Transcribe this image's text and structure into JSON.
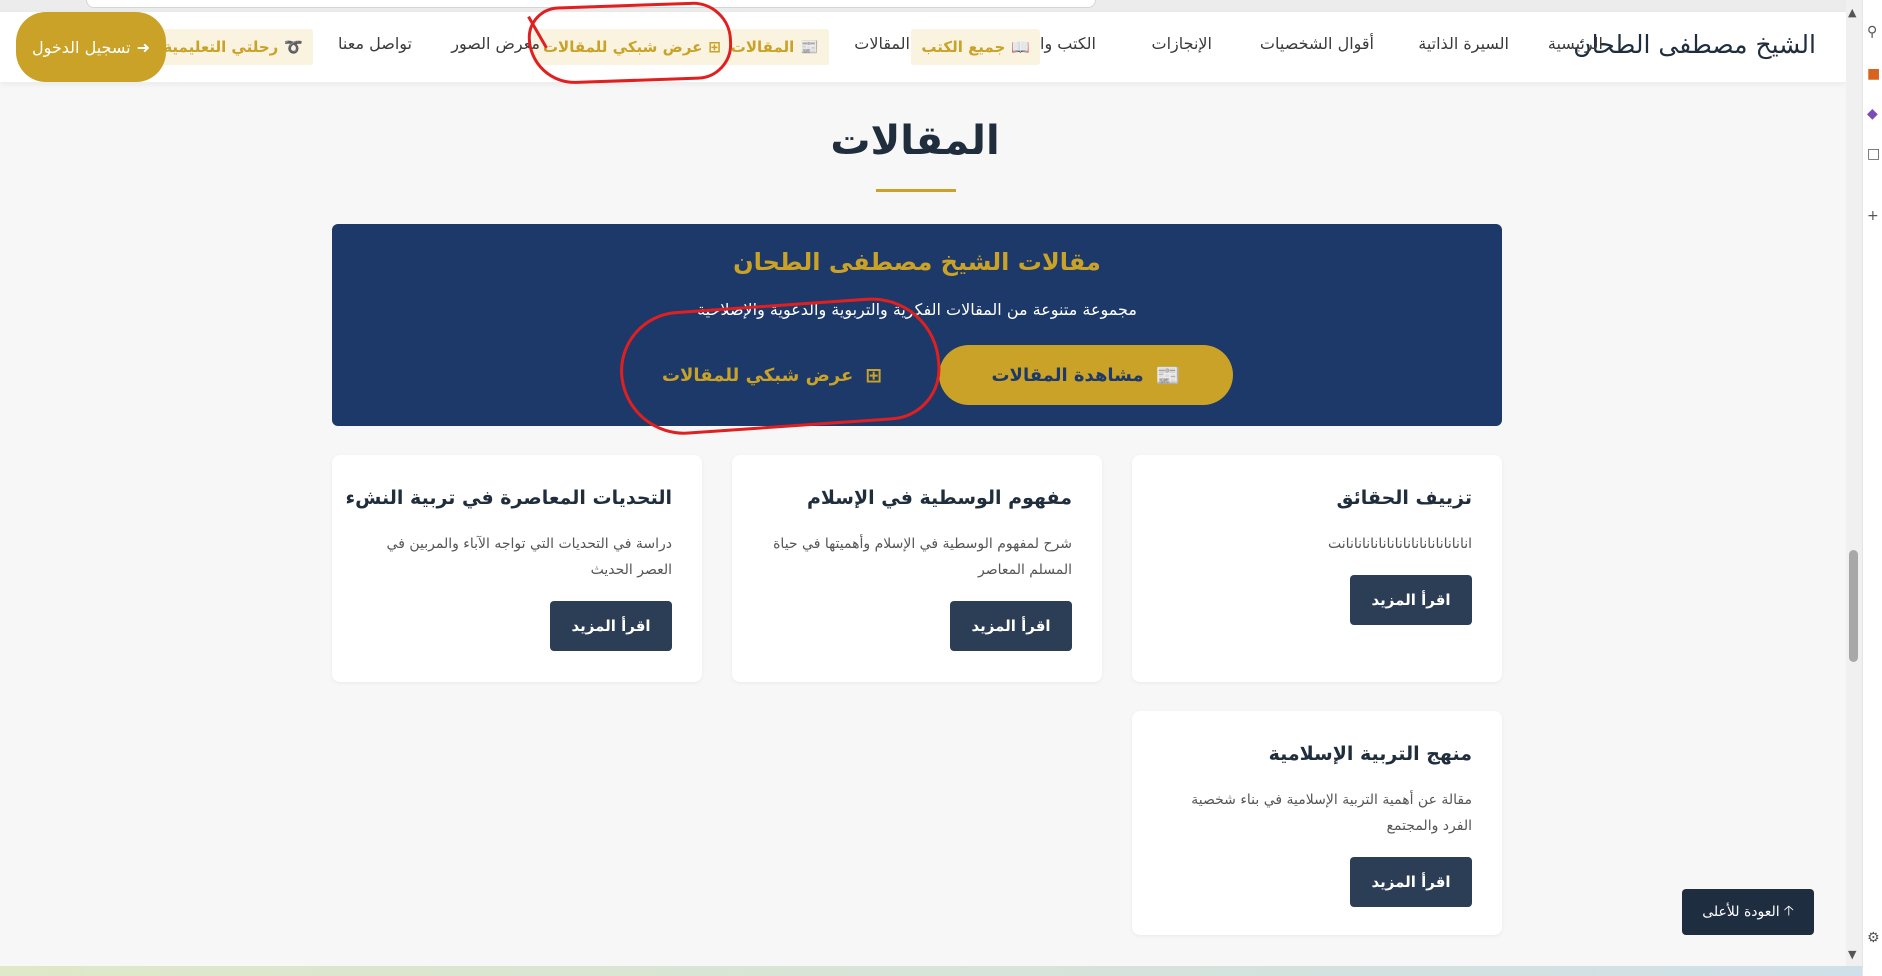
{
  "nav": {
    "brand": "الشيخ مصطفى الطحان",
    "items": [
      "الرئيسية",
      "السيرة الذاتية",
      "أقوال الشخصيات",
      "الإنجازات",
      "الكتب والمؤلفات"
    ],
    "all_books": "جميع الكتب",
    "articles_plain": "المقالات",
    "articles_pill": "المقالات",
    "grid_view": "عرض شبكي للمقالات",
    "gallery": "معرض الصور",
    "contact": "تواصل معنا",
    "journey": "رحلتي التعليمية",
    "login": "تسجيل الدخول"
  },
  "page": {
    "title": "المقالات"
  },
  "hero": {
    "title": "مقالات الشيخ مصطفى الطحان",
    "subtitle": "مجموعة متنوعة من المقالات الفكرية والتربوية والدعوية والإصلاحية",
    "primary_button": "مشاهدة المقالات",
    "secondary_button": "عرض شبكي للمقالات"
  },
  "cards": [
    {
      "title": "تزييف الحقائق",
      "excerpt": "انانانانانانانانانانانانانانانانت",
      "button": "اقرأ المزيد"
    },
    {
      "title": "مفهوم الوسطية في الإسلام",
      "excerpt": "شرح لمفهوم الوسطية في الإسلام وأهميتها في حياة المسلم المعاصر",
      "button": "اقرأ المزيد"
    },
    {
      "title": "التحديات المعاصرة في تربية النشء",
      "excerpt": "دراسة في التحديات التي تواجه الآباء والمربين في العصر الحديث",
      "button": "اقرأ المزيد"
    },
    {
      "title": "منهج التربية الإسلامية",
      "excerpt": "مقالة عن أهمية التربية الإسلامية في بناء شخصية الفرد والمجتمع",
      "button": "اقرأ المزيد"
    }
  ],
  "back_to_top": "العودة للأعلى",
  "icons": {
    "login": "sign-in-icon",
    "journey": "route-icon",
    "grid": "grid-icon",
    "newspaper": "newspaper-icon",
    "book": "book-open-icon",
    "arrow_up": "arrow-up-icon"
  },
  "colors": {
    "gold": "#c9a227",
    "navy": "#1d3969",
    "dark_button": "#2c3e55",
    "annotation": "#e02020"
  }
}
